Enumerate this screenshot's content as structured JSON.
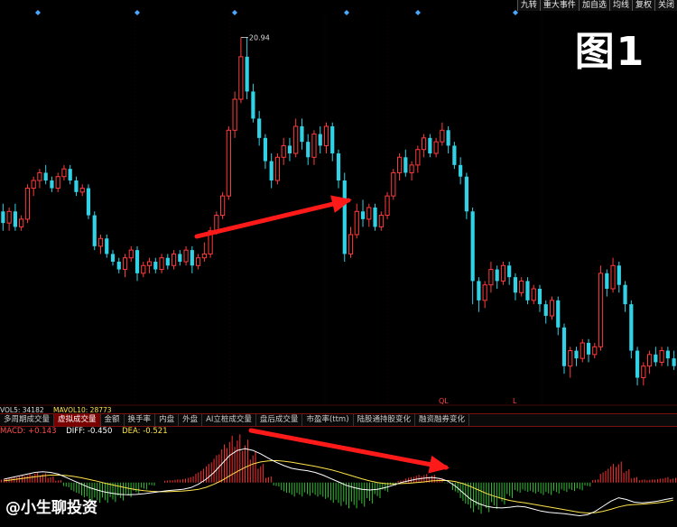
{
  "toolbar": {
    "items": [
      "九转",
      "重大事件",
      "加自选",
      "均线",
      "复权",
      "关闭"
    ]
  },
  "figure_label": "图1",
  "watermark": "@小生聊投资",
  "volume_indicator": {
    "vol5": "VOL5: 34182",
    "mavol10": "MAVOL10: 28773"
  },
  "indicator_tabs": {
    "items": [
      "多周期成交量",
      "虚拟成交量",
      "金额",
      "换手率",
      "内盘",
      "外盘",
      "AI立桩成交量",
      "盘后成交量",
      "市盈率(ttm)",
      "陆股通持股变化",
      "融资融券变化"
    ],
    "active_index": 1
  },
  "markers": {
    "a": "QL",
    "b": "L"
  },
  "macd_readout": {
    "macd": "MACD: +0.143",
    "diff": "DIFF: -0.450",
    "dea": "DEA: -0.521"
  },
  "colors": {
    "up": "#ff3b3b",
    "down": "#32d2e6",
    "diff": "#ffffff",
    "dea": "#ffe34a",
    "hist_up": "#ff3030",
    "hist_down": "#30c030",
    "arrow": "#ff1a1a"
  },
  "chart_data": {
    "type": "candlestick",
    "peak_label": "20.94",
    "candles": [
      {
        "o": 16.4,
        "c": 16.1,
        "h": 16.6,
        "l": 15.9
      },
      {
        "o": 16.1,
        "c": 16.4,
        "h": 16.5,
        "l": 15.9
      },
      {
        "o": 16.4,
        "c": 16.0,
        "h": 16.6,
        "l": 15.9
      },
      {
        "o": 16.0,
        "c": 16.2,
        "h": 16.3,
        "l": 15.9
      },
      {
        "o": 16.2,
        "c": 17.0,
        "h": 17.1,
        "l": 16.1
      },
      {
        "o": 17.0,
        "c": 17.2,
        "h": 17.3,
        "l": 16.8
      },
      {
        "o": 17.2,
        "c": 17.4,
        "h": 17.5,
        "l": 17.0
      },
      {
        "o": 17.4,
        "c": 17.2,
        "h": 17.6,
        "l": 17.1
      },
      {
        "o": 17.2,
        "c": 17.0,
        "h": 17.3,
        "l": 16.9
      },
      {
        "o": 17.0,
        "c": 17.3,
        "h": 17.4,
        "l": 16.9
      },
      {
        "o": 17.3,
        "c": 17.5,
        "h": 17.6,
        "l": 17.2
      },
      {
        "o": 17.5,
        "c": 17.2,
        "h": 17.6,
        "l": 17.1
      },
      {
        "o": 17.2,
        "c": 16.9,
        "h": 17.3,
        "l": 16.8
      },
      {
        "o": 16.9,
        "c": 17.0,
        "h": 17.1,
        "l": 16.8
      },
      {
        "o": 17.0,
        "c": 16.3,
        "h": 17.1,
        "l": 16.2
      },
      {
        "o": 16.3,
        "c": 15.5,
        "h": 16.4,
        "l": 15.4
      },
      {
        "o": 15.5,
        "c": 15.7,
        "h": 15.8,
        "l": 15.3
      },
      {
        "o": 15.7,
        "c": 15.3,
        "h": 15.8,
        "l": 15.2
      },
      {
        "o": 15.3,
        "c": 15.1,
        "h": 15.4,
        "l": 15.0
      },
      {
        "o": 15.1,
        "c": 14.9,
        "h": 15.2,
        "l": 14.8
      },
      {
        "o": 14.9,
        "c": 15.2,
        "h": 15.3,
        "l": 14.7
      },
      {
        "o": 15.2,
        "c": 15.4,
        "h": 15.5,
        "l": 15.1
      },
      {
        "o": 15.4,
        "c": 14.8,
        "h": 15.5,
        "l": 14.6
      },
      {
        "o": 14.8,
        "c": 15.0,
        "h": 15.1,
        "l": 14.7
      },
      {
        "o": 15.0,
        "c": 15.1,
        "h": 15.2,
        "l": 14.8
      },
      {
        "o": 15.1,
        "c": 14.9,
        "h": 15.2,
        "l": 14.8
      },
      {
        "o": 14.9,
        "c": 15.2,
        "h": 15.3,
        "l": 14.8
      },
      {
        "o": 15.2,
        "c": 15.0,
        "h": 15.3,
        "l": 14.9
      },
      {
        "o": 15.0,
        "c": 15.3,
        "h": 15.4,
        "l": 14.9
      },
      {
        "o": 15.3,
        "c": 15.1,
        "h": 15.4,
        "l": 15.0
      },
      {
        "o": 15.1,
        "c": 15.4,
        "h": 15.5,
        "l": 15.0
      },
      {
        "o": 15.4,
        "c": 15.0,
        "h": 15.5,
        "l": 14.8
      },
      {
        "o": 15.0,
        "c": 15.2,
        "h": 15.3,
        "l": 14.9
      },
      {
        "o": 15.2,
        "c": 15.3,
        "h": 15.6,
        "l": 15.1
      },
      {
        "o": 15.3,
        "c": 15.9,
        "h": 16.0,
        "l": 15.2
      },
      {
        "o": 15.9,
        "c": 16.3,
        "h": 16.4,
        "l": 15.8
      },
      {
        "o": 16.3,
        "c": 16.8,
        "h": 16.9,
        "l": 16.2
      },
      {
        "o": 16.8,
        "c": 18.5,
        "h": 18.6,
        "l": 16.7
      },
      {
        "o": 18.5,
        "c": 19.3,
        "h": 19.5,
        "l": 18.3
      },
      {
        "o": 19.3,
        "c": 20.4,
        "h": 20.9,
        "l": 19.2
      },
      {
        "o": 20.4,
        "c": 19.5,
        "h": 20.9,
        "l": 19.3
      },
      {
        "o": 19.5,
        "c": 18.8,
        "h": 19.7,
        "l": 18.7
      },
      {
        "o": 18.8,
        "c": 18.3,
        "h": 19.0,
        "l": 18.1
      },
      {
        "o": 18.3,
        "c": 17.7,
        "h": 18.4,
        "l": 17.5
      },
      {
        "o": 17.7,
        "c": 17.2,
        "h": 17.9,
        "l": 17.0
      },
      {
        "o": 17.2,
        "c": 17.8,
        "h": 17.9,
        "l": 17.1
      },
      {
        "o": 17.8,
        "c": 18.1,
        "h": 18.3,
        "l": 17.6
      },
      {
        "o": 18.1,
        "c": 17.9,
        "h": 18.3,
        "l": 17.7
      },
      {
        "o": 17.9,
        "c": 18.6,
        "h": 18.8,
        "l": 17.8
      },
      {
        "o": 18.6,
        "c": 18.2,
        "h": 18.8,
        "l": 18.0
      },
      {
        "o": 18.2,
        "c": 17.8,
        "h": 18.4,
        "l": 17.6
      },
      {
        "o": 17.8,
        "c": 18.4,
        "h": 18.5,
        "l": 17.6
      },
      {
        "o": 18.4,
        "c": 18.1,
        "h": 18.6,
        "l": 17.9
      },
      {
        "o": 18.1,
        "c": 18.6,
        "h": 18.7,
        "l": 17.9
      },
      {
        "o": 18.6,
        "c": 17.9,
        "h": 18.7,
        "l": 17.7
      },
      {
        "o": 17.9,
        "c": 17.2,
        "h": 18.0,
        "l": 17.0
      },
      {
        "o": 17.2,
        "c": 15.3,
        "h": 17.4,
        "l": 15.1
      },
      {
        "o": 15.3,
        "c": 15.8,
        "h": 16.0,
        "l": 15.2
      },
      {
        "o": 15.8,
        "c": 16.4,
        "h": 16.6,
        "l": 15.7
      },
      {
        "o": 16.4,
        "c": 16.2,
        "h": 16.7,
        "l": 16.0
      },
      {
        "o": 16.2,
        "c": 16.5,
        "h": 16.6,
        "l": 16.0
      },
      {
        "o": 16.5,
        "c": 16.0,
        "h": 16.6,
        "l": 15.9
      },
      {
        "o": 16.0,
        "c": 16.3,
        "h": 16.4,
        "l": 15.9
      },
      {
        "o": 16.3,
        "c": 16.8,
        "h": 16.9,
        "l": 16.2
      },
      {
        "o": 16.8,
        "c": 17.4,
        "h": 17.5,
        "l": 16.7
      },
      {
        "o": 17.4,
        "c": 17.8,
        "h": 17.9,
        "l": 17.2
      },
      {
        "o": 17.8,
        "c": 17.4,
        "h": 18.0,
        "l": 17.3
      },
      {
        "o": 17.4,
        "c": 17.6,
        "h": 17.7,
        "l": 17.2
      },
      {
        "o": 17.6,
        "c": 18.0,
        "h": 18.1,
        "l": 17.4
      },
      {
        "o": 18.0,
        "c": 18.3,
        "h": 18.4,
        "l": 17.8
      },
      {
        "o": 18.3,
        "c": 17.9,
        "h": 18.4,
        "l": 17.8
      },
      {
        "o": 17.9,
        "c": 18.2,
        "h": 18.3,
        "l": 17.8
      },
      {
        "o": 18.2,
        "c": 18.5,
        "h": 18.7,
        "l": 18.1
      },
      {
        "o": 18.5,
        "c": 18.1,
        "h": 18.6,
        "l": 17.9
      },
      {
        "o": 18.1,
        "c": 17.6,
        "h": 18.2,
        "l": 17.5
      },
      {
        "o": 17.6,
        "c": 17.3,
        "h": 17.8,
        "l": 17.1
      },
      {
        "o": 17.3,
        "c": 16.4,
        "h": 17.4,
        "l": 16.2
      },
      {
        "o": 16.4,
        "c": 14.6,
        "h": 16.5,
        "l": 14.0
      },
      {
        "o": 14.6,
        "c": 14.1,
        "h": 14.7,
        "l": 13.8
      },
      {
        "o": 14.1,
        "c": 14.5,
        "h": 14.6,
        "l": 13.9
      },
      {
        "o": 14.5,
        "c": 14.9,
        "h": 15.1,
        "l": 14.3
      },
      {
        "o": 14.9,
        "c": 14.6,
        "h": 15.0,
        "l": 14.4
      },
      {
        "o": 14.6,
        "c": 15.0,
        "h": 15.1,
        "l": 14.5
      },
      {
        "o": 15.0,
        "c": 14.7,
        "h": 15.1,
        "l": 14.5
      },
      {
        "o": 14.7,
        "c": 14.3,
        "h": 14.8,
        "l": 14.1
      },
      {
        "o": 14.3,
        "c": 14.6,
        "h": 14.7,
        "l": 14.2
      },
      {
        "o": 14.6,
        "c": 14.1,
        "h": 14.7,
        "l": 14.0
      },
      {
        "o": 14.1,
        "c": 14.4,
        "h": 14.5,
        "l": 14.0
      },
      {
        "o": 14.4,
        "c": 14.0,
        "h": 14.5,
        "l": 13.8
      },
      {
        "o": 14.0,
        "c": 13.7,
        "h": 14.1,
        "l": 13.5
      },
      {
        "o": 13.7,
        "c": 14.1,
        "h": 14.2,
        "l": 13.6
      },
      {
        "o": 14.1,
        "c": 13.4,
        "h": 14.2,
        "l": 13.2
      },
      {
        "o": 13.4,
        "c": 12.4,
        "h": 13.5,
        "l": 12.2
      },
      {
        "o": 12.4,
        "c": 12.8,
        "h": 12.9,
        "l": 12.1
      },
      {
        "o": 12.8,
        "c": 12.6,
        "h": 12.9,
        "l": 12.4
      },
      {
        "o": 12.6,
        "c": 13.0,
        "h": 13.1,
        "l": 12.5
      },
      {
        "o": 13.0,
        "c": 12.7,
        "h": 13.1,
        "l": 12.5
      },
      {
        "o": 12.7,
        "c": 12.9,
        "h": 13.0,
        "l": 12.6
      },
      {
        "o": 12.9,
        "c": 14.8,
        "h": 15.0,
        "l": 12.8
      },
      {
        "o": 14.8,
        "c": 14.4,
        "h": 14.9,
        "l": 14.2
      },
      {
        "o": 14.4,
        "c": 15.0,
        "h": 15.2,
        "l": 14.3
      },
      {
        "o": 15.0,
        "c": 14.5,
        "h": 15.1,
        "l": 14.3
      },
      {
        "o": 14.5,
        "c": 14.0,
        "h": 14.6,
        "l": 13.8
      },
      {
        "o": 14.0,
        "c": 12.8,
        "h": 14.1,
        "l": 12.6
      },
      {
        "o": 12.8,
        "c": 12.1,
        "h": 12.9,
        "l": 11.9
      },
      {
        "o": 12.1,
        "c": 12.4,
        "h": 12.5,
        "l": 11.9
      },
      {
        "o": 12.4,
        "c": 12.7,
        "h": 12.8,
        "l": 12.2
      },
      {
        "o": 12.7,
        "c": 12.5,
        "h": 12.9,
        "l": 12.4
      },
      {
        "o": 12.5,
        "c": 12.8,
        "h": 12.9,
        "l": 12.4
      },
      {
        "o": 12.8,
        "c": 12.6,
        "h": 12.9,
        "l": 12.4
      },
      {
        "o": 12.6,
        "c": 12.4,
        "h": 12.8,
        "l": 12.3
      }
    ],
    "macd": {
      "diff": [
        0.1,
        0.15,
        0.2,
        0.25,
        0.3,
        0.32,
        0.3,
        0.25,
        0.15,
        0.05,
        -0.05,
        -0.15,
        -0.22,
        -0.28,
        -0.32,
        -0.35,
        -0.36,
        -0.35,
        -0.33,
        -0.3,
        -0.27,
        -0.24,
        -0.22,
        -0.2,
        -0.15,
        -0.05,
        0.1,
        0.3,
        0.55,
        0.8,
        0.95,
        1.0,
        0.95,
        0.85,
        0.72,
        0.6,
        0.5,
        0.42,
        0.38,
        0.35,
        0.3,
        0.22,
        0.12,
        0.02,
        -0.08,
        -0.15,
        -0.2,
        -0.22,
        -0.2,
        -0.15,
        -0.08,
        0.0,
        0.05,
        0.1,
        0.13,
        0.15,
        0.12,
        0.05,
        -0.1,
        -0.3,
        -0.5,
        -0.62,
        -0.7,
        -0.74,
        -0.75,
        -0.73,
        -0.7,
        -0.72,
        -0.78,
        -0.84,
        -0.88,
        -0.9,
        -0.92,
        -0.95,
        -0.98,
        -0.95,
        -0.85,
        -0.7,
        -0.55,
        -0.45,
        -0.5,
        -0.58,
        -0.6,
        -0.58,
        -0.55,
        -0.5,
        -0.46
      ],
      "dea": [
        0.05,
        0.08,
        0.11,
        0.14,
        0.17,
        0.2,
        0.22,
        0.22,
        0.21,
        0.18,
        0.14,
        0.09,
        0.04,
        -0.02,
        -0.07,
        -0.12,
        -0.17,
        -0.21,
        -0.24,
        -0.26,
        -0.27,
        -0.27,
        -0.26,
        -0.25,
        -0.23,
        -0.2,
        -0.14,
        -0.05,
        0.06,
        0.2,
        0.33,
        0.45,
        0.55,
        0.61,
        0.64,
        0.65,
        0.63,
        0.6,
        0.56,
        0.52,
        0.48,
        0.43,
        0.38,
        0.32,
        0.25,
        0.18,
        0.11,
        0.05,
        0.0,
        -0.03,
        -0.04,
        -0.03,
        -0.02,
        0.0,
        0.02,
        0.05,
        0.06,
        0.06,
        0.03,
        -0.03,
        -0.12,
        -0.22,
        -0.32,
        -0.4,
        -0.47,
        -0.53,
        -0.57,
        -0.6,
        -0.64,
        -0.68,
        -0.72,
        -0.76,
        -0.8,
        -0.84,
        -0.88,
        -0.9,
        -0.89,
        -0.85,
        -0.79,
        -0.72,
        -0.67,
        -0.65,
        -0.64,
        -0.62,
        -0.6,
        -0.57,
        -0.52
      ],
      "hist": [
        0.1,
        0.14,
        0.18,
        0.22,
        0.26,
        0.24,
        0.16,
        0.06,
        -0.12,
        -0.26,
        -0.38,
        -0.48,
        -0.52,
        -0.52,
        -0.5,
        -0.46,
        -0.38,
        -0.28,
        -0.18,
        -0.08,
        0.0,
        0.06,
        0.08,
        0.1,
        0.16,
        0.3,
        0.48,
        0.7,
        0.98,
        1.2,
        1.24,
        1.1,
        0.8,
        0.48,
        0.16,
        -0.1,
        -0.26,
        -0.36,
        -0.36,
        -0.34,
        -0.36,
        -0.42,
        -0.52,
        -0.6,
        -0.66,
        -0.66,
        -0.62,
        -0.54,
        -0.4,
        -0.24,
        -0.08,
        0.06,
        0.14,
        0.2,
        0.22,
        0.2,
        0.12,
        -0.02,
        -0.26,
        -0.54,
        -0.76,
        -0.8,
        -0.76,
        -0.68,
        -0.56,
        -0.4,
        -0.26,
        -0.24,
        -0.28,
        -0.32,
        -0.32,
        -0.28,
        -0.24,
        -0.22,
        -0.2,
        -0.1,
        0.08,
        0.3,
        0.48,
        0.54,
        0.34,
        0.14,
        0.08,
        0.08,
        0.1,
        0.14,
        0.12
      ]
    }
  }
}
